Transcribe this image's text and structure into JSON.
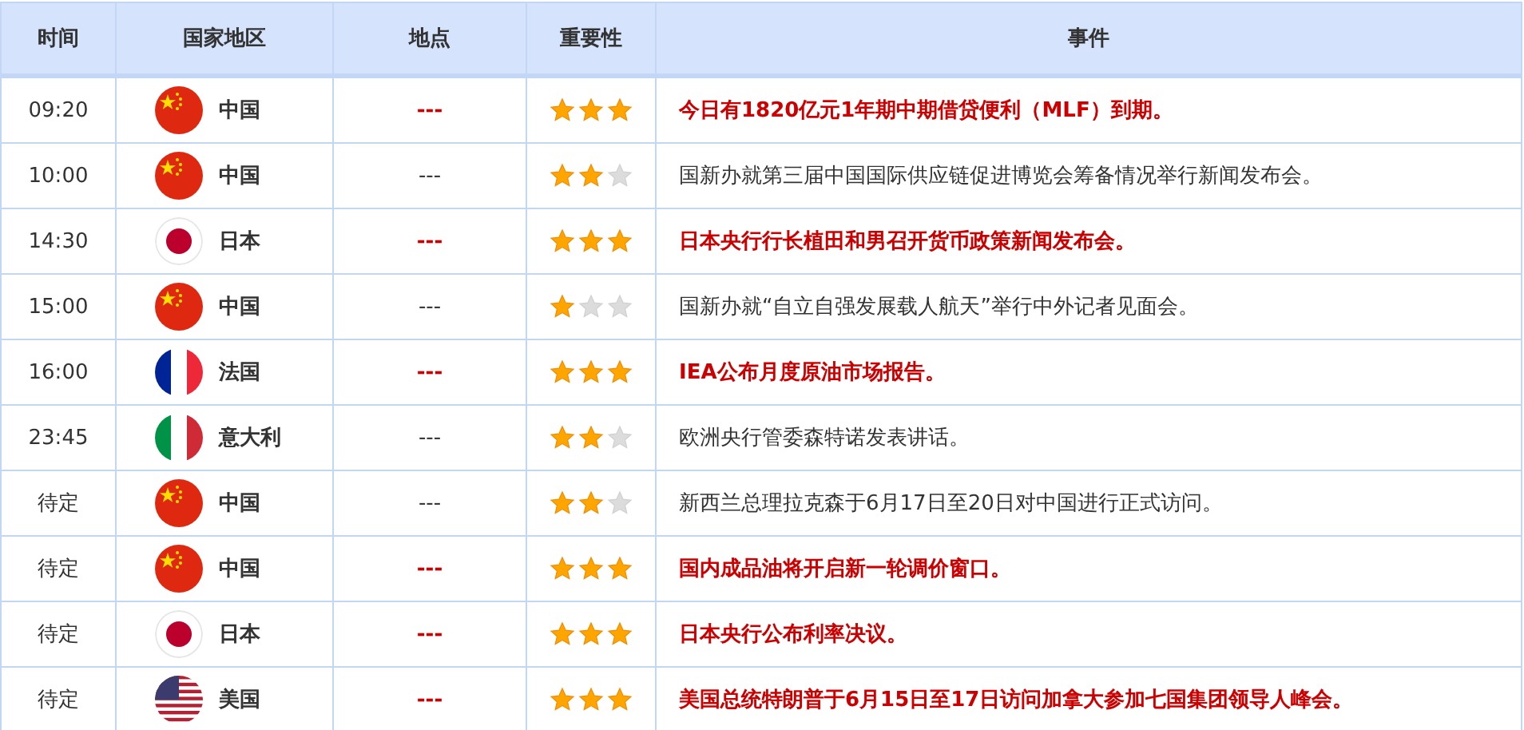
{
  "columns": [
    "时间",
    "国家地区",
    "地点",
    "重要性",
    "事件"
  ],
  "rows": [
    {
      "time": "09:20",
      "kind": "cn",
      "country": "中国",
      "place": "---",
      "stars": 3,
      "event": "今日有1820亿元1年期中期借贷便利（MLF）到期。"
    },
    {
      "time": "10:00",
      "kind": "cn",
      "country": "中国",
      "place": "---",
      "stars": 2,
      "event": "国新办就第三届中国国际供应链促进博览会筹备情况举行新闻发布会。"
    },
    {
      "time": "14:30",
      "kind": "jp",
      "country": "日本",
      "place": "---",
      "stars": 3,
      "event": "日本央行行长植田和男召开货币政策新闻发布会。"
    },
    {
      "time": "15:00",
      "kind": "cn",
      "country": "中国",
      "place": "---",
      "stars": 1,
      "event": "国新办就“自立自强发展载人航天”举行中外记者见面会。"
    },
    {
      "time": "16:00",
      "kind": "fr",
      "country": "法国",
      "place": "---",
      "stars": 3,
      "event": "IEA公布月度原油市场报告。"
    },
    {
      "time": "23:45",
      "kind": "it",
      "country": "意大利",
      "place": "---",
      "stars": 2,
      "event": "欧洲央行管委森特诺发表讲话。"
    },
    {
      "time": "待定",
      "kind": "cn",
      "country": "中国",
      "place": "---",
      "stars": 2,
      "event": "新西兰总理拉克森于6月17日至20日对中国进行正式访问。"
    },
    {
      "time": "待定",
      "kind": "cn",
      "country": "中国",
      "place": "---",
      "stars": 3,
      "event": "国内成品油将开启新一轮调价窗口。"
    },
    {
      "time": "待定",
      "kind": "jp",
      "country": "日本",
      "place": "---",
      "stars": 3,
      "event": "日本央行公布利率决议。"
    },
    {
      "time": "待定",
      "kind": "us",
      "country": "美国",
      "place": "---",
      "stars": 3,
      "event": "美国总统特朗普于6月15日至17日访问加拿大参加七国集团领导人峰会。"
    }
  ]
}
